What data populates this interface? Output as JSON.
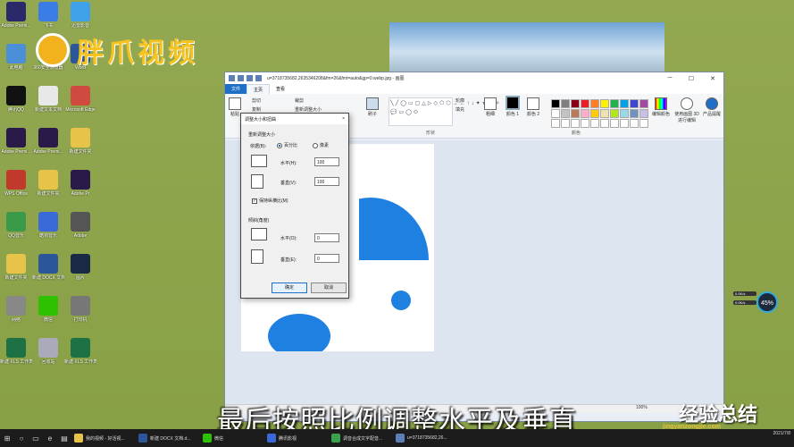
{
  "desktop": {
    "icons": [
      {
        "label": "Adobe Premi...",
        "color": "#2a2a6a"
      },
      {
        "label": "飞书",
        "color": "#3b7de6"
      },
      {
        "label": "迅雷影音",
        "color": "#3fa1e8"
      },
      {
        "label": "此电脑",
        "color": "#4a8fd8"
      },
      {
        "label": "360安全浏览器",
        "color": "#3aa24a"
      },
      {
        "label": "Word",
        "color": "#2b579a"
      },
      {
        "label": "腾讯QQ",
        "color": "#111"
      },
      {
        "label": "新建文本文档",
        "color": "#e8e8e8"
      },
      {
        "label": "Microsoft Edge",
        "color": "#d04a3f"
      },
      {
        "label": "Adobe Premi...",
        "color": "#2a1a4a"
      },
      {
        "label": "Adobe Premi...",
        "color": "#2a1a4a"
      },
      {
        "label": "新建文件夹",
        "color": "#e8c34a"
      },
      {
        "label": "WPS Office",
        "color": "#c0392b"
      },
      {
        "label": "新建文件夹",
        "color": "#e8c34a"
      },
      {
        "label": "Adobe Pr",
        "color": "#2a1a4a"
      },
      {
        "label": "QQ音乐",
        "color": "#3a9a4a"
      },
      {
        "label": "酷狗音乐",
        "color": "#3a6ad8"
      },
      {
        "label": "Adobe",
        "color": "#555"
      },
      {
        "label": "新建文件夹",
        "color": "#e8c34a"
      },
      {
        "label": "新建 DOCX 文档",
        "color": "#2b579a"
      },
      {
        "label": "图片",
        "color": "#1b2a44"
      },
      {
        "label": "网络",
        "color": "#888"
      },
      {
        "label": "微信",
        "color": "#2dc100"
      },
      {
        "label": "打印机",
        "color": "#777"
      },
      {
        "label": "新建 XLS 工作表",
        "color": "#1e7145"
      },
      {
        "label": "回收站",
        "color": "#aab"
      },
      {
        "label": "新建 XLS 工作表",
        "color": "#1e7145"
      }
    ]
  },
  "watermark": {
    "text": "胖爪视频"
  },
  "paint": {
    "title": "u=3718735682,2635346208&fm=26&fmt=auto&gp=0.webp.jpg - 画图",
    "tabs": {
      "file": "文件",
      "home": "主页",
      "view": "查看"
    },
    "ribbon": {
      "paste": "粘贴",
      "cut": "剪切",
      "copy": "复制",
      "crop": "裁剪",
      "resize": "重新调整大小",
      "brush": "刷子",
      "outline": "轮廓",
      "fill": "填充",
      "shapes_group": "形状",
      "size": "粗细",
      "color1": "颜色 1",
      "color2": "颜色 2",
      "edit_colors": "编辑颜色",
      "paint3d": "使用画图 3D 进行编辑",
      "product_alert": "产品提醒",
      "colors_group": "颜色",
      "shapes_glyphs": "╲╱◯▭▢△▷◇⬠⬡→←↑↓✦★☆✧💬▭◯⬭"
    },
    "palette": [
      "#000000",
      "#7f7f7f",
      "#880015",
      "#ed1c24",
      "#ff7f27",
      "#fff200",
      "#22b14c",
      "#00a2e8",
      "#3f48cc",
      "#a349a4",
      "#ffffff",
      "#c3c3c3",
      "#b97a57",
      "#ffaec9",
      "#ffc90e",
      "#efe4b0",
      "#b5e61d",
      "#99d9ea",
      "#7092be",
      "#c8bfe7",
      "#ffffff",
      "#ffffff",
      "#ffffff",
      "#ffffff",
      "#ffffff",
      "#ffffff",
      "#ffffff",
      "#ffffff",
      "#ffffff",
      "#ffffff"
    ],
    "status_zoom": "100%"
  },
  "dialog": {
    "title": "调整大小和扭曲",
    "close": "×",
    "resize_section": "重新调整大小",
    "by_label": "依据(B):",
    "percent": "百分比",
    "pixels": "像素",
    "horizontal_label": "水平(H):",
    "horizontal_value": "100",
    "vertical_label": "垂直(V):",
    "vertical_value": "100",
    "keep_ratio": "保持纵横比(M)",
    "skew_section": "倾斜(角度)",
    "skew_h_label": "水平(O):",
    "skew_h_value": "0",
    "skew_v_label": "垂直(E):",
    "skew_v_value": "0",
    "ok": "确定",
    "cancel": "取消"
  },
  "subtitle": "最后按照比例调整水平及垂直",
  "brand": {
    "logo": "经验总结",
    "url": "jingyanzongjie.com"
  },
  "widget": {
    "percent": "45%",
    "up": "0.0K/s",
    "down": "0.0K/s"
  },
  "taskbar": {
    "apps": [
      {
        "label": "我的视频 - 好活视...",
        "color": "#e8c34a"
      },
      {
        "label": "新建 DOCX 文档.d...",
        "color": "#2b579a"
      },
      {
        "label": "微信",
        "color": "#2dc100"
      },
      {
        "label": "腾讯影视",
        "color": "#3a6ad8"
      },
      {
        "label": "调音合成文字配音...",
        "color": "#3aa24a"
      },
      {
        "label": "u=3718735682,26...",
        "color": "#5b7fb6"
      }
    ],
    "date": "2021/7/8"
  }
}
